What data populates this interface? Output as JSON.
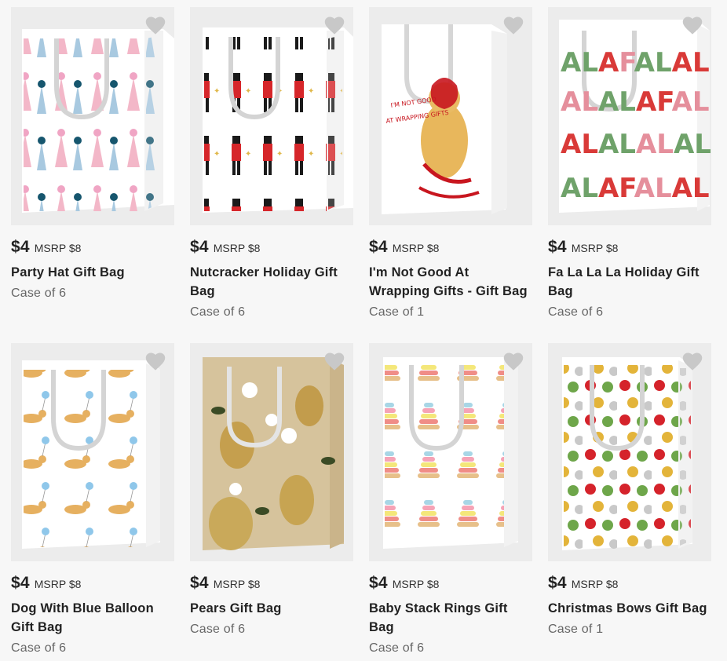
{
  "products": [
    {
      "price": "$4",
      "msrp": "MSRP $8",
      "name": "Party Hat Gift Bag",
      "case": "Case of 6",
      "pattern": "party-hat"
    },
    {
      "price": "$4",
      "msrp": "MSRP $8",
      "name": "Nutcracker Holiday Gift Bag",
      "case": "Case of 6",
      "pattern": "nutcracker"
    },
    {
      "price": "$4",
      "msrp": "MSRP $8",
      "name": "I'm Not Good At Wrapping Gifts - Gift Bag",
      "case": "Case of 1",
      "pattern": "dog-bow",
      "bag_text": "I'M NOT GOOD AT WRAPPING GIFTS"
    },
    {
      "price": "$4",
      "msrp": "MSRP $8",
      "name": "Fa La La La Holiday Gift Bag",
      "case": "Case of 6",
      "pattern": "falala",
      "bag_text": "FALALALA"
    },
    {
      "price": "$4",
      "msrp": "MSRP $8",
      "name": "Dog With Blue Balloon Gift Bag",
      "case": "Case of 6",
      "pattern": "dog-balloon"
    },
    {
      "price": "$4",
      "msrp": "MSRP $8",
      "name": "Pears Gift Bag",
      "case": "Case of 6",
      "pattern": "pears"
    },
    {
      "price": "$4",
      "msrp": "MSRP $8",
      "name": "Baby Stack Rings Gift Bag",
      "case": "Case of 6",
      "pattern": "stack-rings"
    },
    {
      "price": "$4",
      "msrp": "MSRP $8",
      "name": "Christmas Bows Gift Bag",
      "case": "Case of 1",
      "pattern": "bows"
    }
  ],
  "icons": {
    "favorite": "heart-icon"
  },
  "colors": {
    "heart": "#c8c8c8",
    "card_bg": "#efefef",
    "page_bg": "#f7f7f7"
  }
}
